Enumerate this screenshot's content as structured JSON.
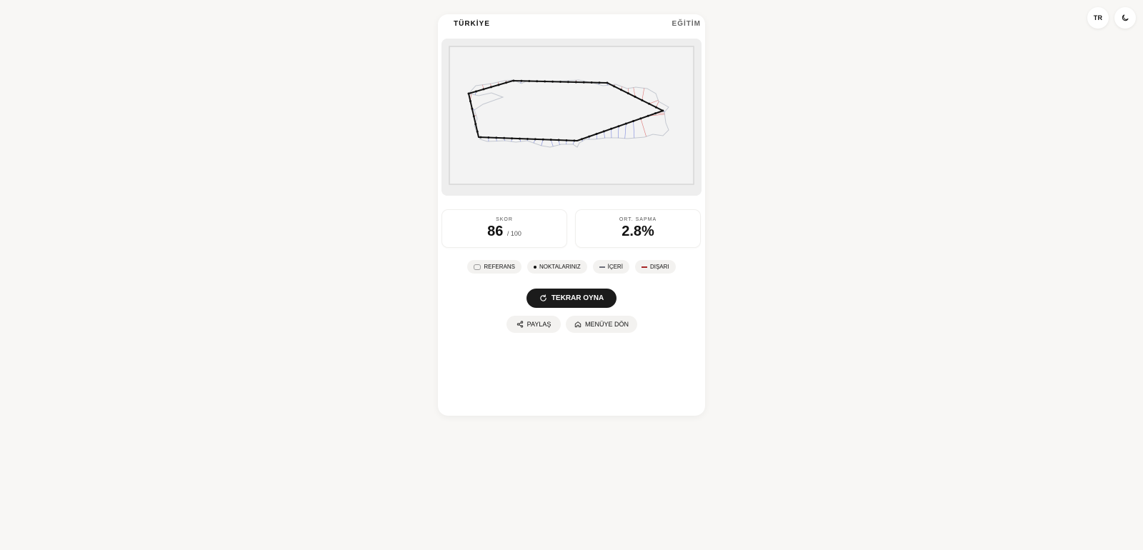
{
  "topbar": {
    "language": "TR",
    "theme_icon": "moon-icon"
  },
  "header": {
    "title": "TÜRKİYE",
    "mode": "EĞİTİM"
  },
  "map": {
    "outline_color": "#c4c8d0",
    "inside_color": "#4a5bd6",
    "outside_color": "#d64545",
    "player_color": "#111111"
  },
  "stats": {
    "score_label": "SKOR",
    "score_value": "86",
    "score_suffix": "/ 100",
    "deviation_label": "ORT. SAPMA",
    "deviation_value": "2.8%"
  },
  "legend": {
    "reference": "REFERANS",
    "points": "NOKTALARINIZ",
    "inside": "İÇERİ",
    "outside": "DIŞARI"
  },
  "actions": {
    "play_again": "TEKRAR OYNA",
    "share": "PAYLAŞ",
    "menu": "MENÜYE DÖN"
  }
}
